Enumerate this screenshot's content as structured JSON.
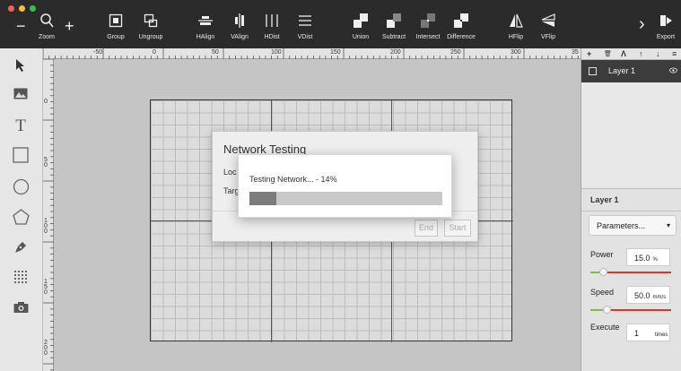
{
  "toolbar": {
    "zoom_minus": "−",
    "zoom_icon": "search-icon",
    "zoom_label": "Zoom",
    "zoom_plus": "+",
    "group_label": "Group",
    "ungroup_label": "Ungroup",
    "halign_label": "HAlign",
    "valign_label": "VAlign",
    "hdist_label": "HDist",
    "vdist_label": "VDist",
    "union_label": "Union",
    "subtract_label": "Subtract",
    "intersect_label": "Intersect",
    "difference_label": "Difference",
    "hflip_label": "HFlip",
    "vflip_label": "VFlip",
    "more_chevron": "›",
    "export_label": "Export"
  },
  "left_tools": [
    "select-arrow-icon",
    "image-icon",
    "text-icon",
    "rectangle-icon",
    "ellipse-icon",
    "polygon-icon",
    "pen-icon",
    "grid-icon",
    "camera-icon"
  ],
  "text_tool_glyph": "T",
  "ruler": {
    "top_labels": [
      "-50",
      "0",
      "50",
      "100",
      "150",
      "200",
      "250",
      "300",
      "35"
    ],
    "left_labels": [
      "0",
      "5\n0",
      "1\n0\n0",
      "1\n5\n0",
      "2\n0\n0"
    ]
  },
  "dialog": {
    "title": "Network Testing",
    "location_label": "Loc",
    "target_label": "Targ",
    "end_button": "End",
    "start_button": "Start"
  },
  "progress": {
    "text": "Testing Network... - 14%",
    "value": 0.14
  },
  "right_panel": {
    "toolbar_icons": [
      "+",
      "🗑",
      "Λ",
      "↑",
      "↓",
      "≡"
    ],
    "layer_name": "Layer 1",
    "props_title": "Layer 1",
    "preset_select": "Parameters...",
    "preset_caret": "▾",
    "power_label": "Power",
    "power_value": "15.0",
    "power_unit": "%",
    "power_level": 0.16,
    "speed_label": "Speed",
    "speed_value": "50.0",
    "speed_unit": "mm/s",
    "speed_level": 0.2,
    "execute_label": "Execute",
    "execute_value": "1",
    "execute_unit": "times"
  },
  "colors": {
    "toolbar_bg": "#2b2b2b",
    "slider_green": "#7fbf3b",
    "slider_red": "#d23a2a",
    "progress_fill": "#7c7c7c"
  }
}
